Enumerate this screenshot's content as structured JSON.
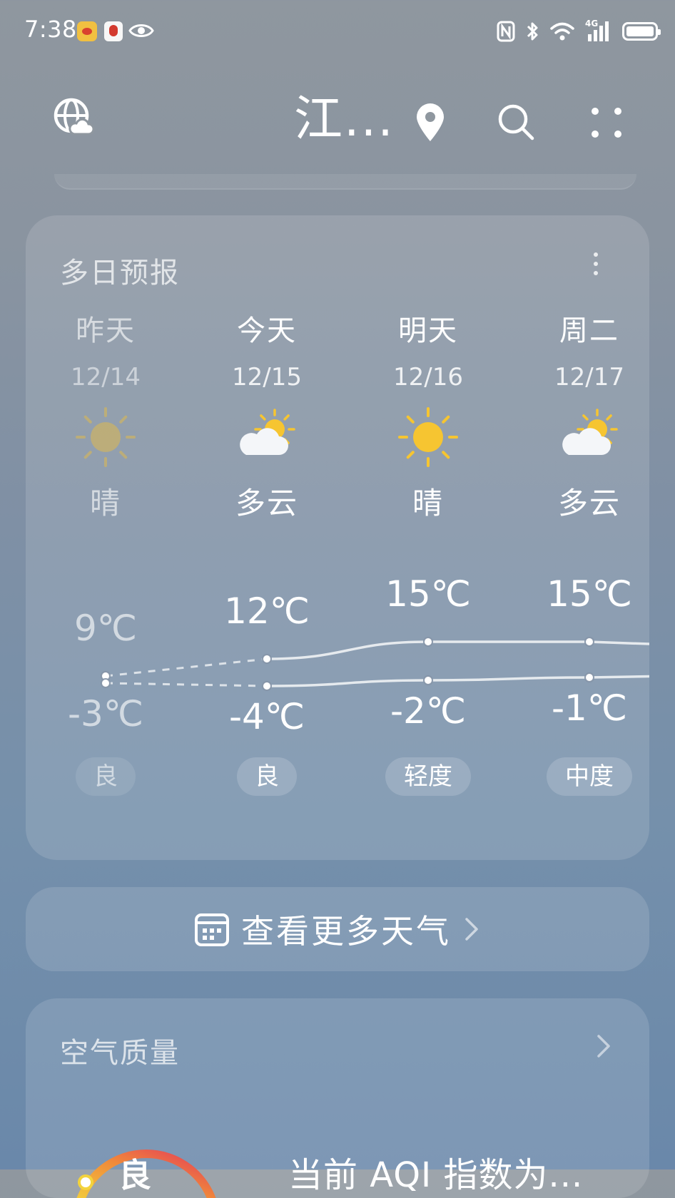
{
  "status_bar": {
    "time": "7:38",
    "notification_icons": [
      "weibo-icon",
      "red-app-icon",
      "eye-icon"
    ],
    "system_icons": [
      "nfc-icon",
      "bluetooth-icon",
      "wifi-icon",
      "signal-4g-icon",
      "battery-icon"
    ],
    "network_label": "4G"
  },
  "top_bar": {
    "city": "江...",
    "icons": [
      "globe-cloud-icon",
      "location-pin-icon",
      "search-icon",
      "grid-menu-icon"
    ]
  },
  "forecast": {
    "title": "多日预报",
    "days": [
      {
        "name": "昨天",
        "date": "12/14",
        "condition": "晴",
        "icon": "sun-icon",
        "high": "9℃",
        "low": "-3℃",
        "high_value": 9,
        "low_value": -3,
        "aqi": "良",
        "past": true
      },
      {
        "name": "今天",
        "date": "12/15",
        "condition": "多云",
        "icon": "partly-cloudy-icon",
        "high": "12℃",
        "low": "-4℃",
        "high_value": 12,
        "low_value": -4,
        "aqi": "良",
        "past": false
      },
      {
        "name": "明天",
        "date": "12/16",
        "condition": "晴",
        "icon": "sun-icon",
        "high": "15℃",
        "low": "-2℃",
        "high_value": 15,
        "low_value": -2,
        "aqi": "轻度",
        "past": false
      },
      {
        "name": "周二",
        "date": "12/17",
        "condition": "多云",
        "icon": "partly-cloudy-icon",
        "high": "15℃",
        "low": "-1℃",
        "high_value": 15,
        "low_value": -1,
        "aqi": "中度",
        "past": false
      }
    ]
  },
  "more_weather": {
    "label": "查看更多天气"
  },
  "air_quality": {
    "title": "空气质量",
    "level": "良",
    "description": "当前 AQI 指数为..."
  },
  "colors": {
    "sun": "#f6c531",
    "sun_past": "#d6b75a",
    "gauge_start": "#f3d33d",
    "gauge_end": "#e43a5a"
  }
}
